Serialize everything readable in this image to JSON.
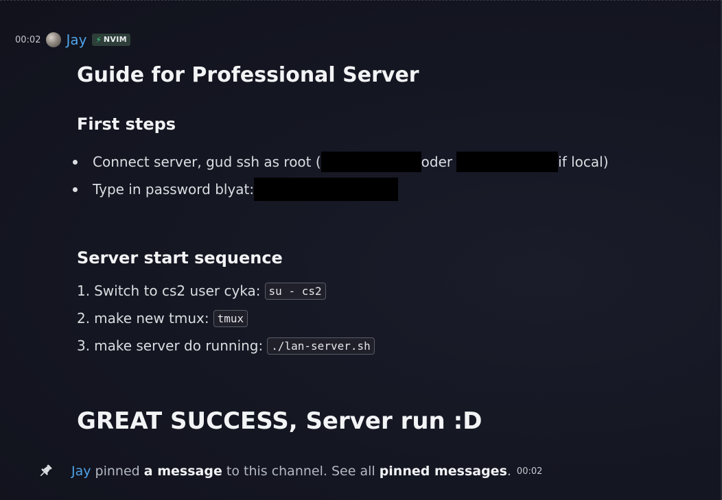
{
  "message": {
    "timestamp": "00:02",
    "author": "Jay",
    "tag": {
      "icon": "lightning-icon",
      "label": "NVIM"
    }
  },
  "content": {
    "title": "Guide for Professional Server",
    "section1": {
      "heading": "First steps",
      "items": [
        {
          "part1": "Connect server, gud ssh as root (",
          "part2": "oder",
          "part3": "if local)"
        },
        {
          "part1": "Type in password blyat:"
        }
      ]
    },
    "section2": {
      "heading": "Server start sequence",
      "steps": [
        {
          "number": "1.",
          "text": "Switch to cs2 user cyka:",
          "code": "su - cs2"
        },
        {
          "number": "2.",
          "text": "make new tmux:",
          "code": "tmux"
        },
        {
          "number": "3.",
          "text": "make server do running:",
          "code": "./lan-server.sh"
        }
      ]
    },
    "closing": "GREAT SUCCESS, Server run :D"
  },
  "system": {
    "icon": "pin-icon",
    "user": "Jay",
    "text1": "pinned",
    "strong1": "a message",
    "text2": "to this channel. See all",
    "strong2": "pinned messages",
    "text3": ".",
    "timestamp": "00:02"
  }
}
